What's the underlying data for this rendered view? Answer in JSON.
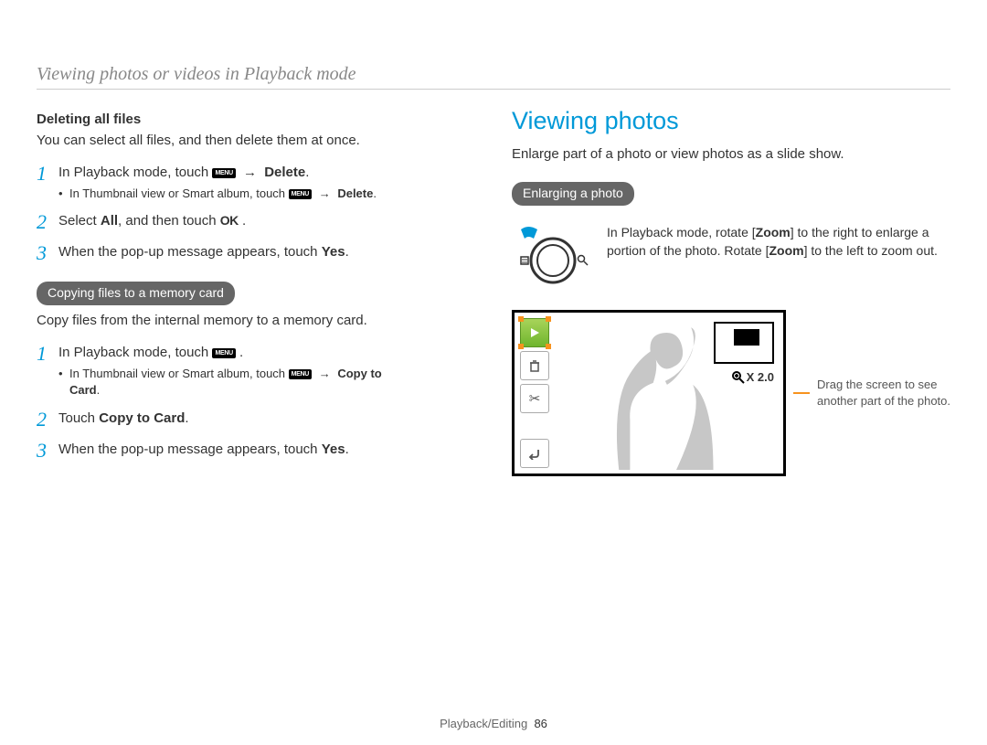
{
  "header": "Viewing photos or videos in Playback mode",
  "left": {
    "del_title": "Deleting all files",
    "del_desc": "You can select all files, and then delete them at once.",
    "del_steps": {
      "s1_pre": "In Playback mode, touch ",
      "s1_post": "Delete",
      "s1_sub_pre": "In Thumbnail view or Smart album, touch ",
      "s1_sub_post": "Delete",
      "s2_pre": "Select ",
      "s2_bold": "All",
      "s2_post": ", and then touch ",
      "s3_pre": "When the pop-up message appears, touch ",
      "s3_bold": "Yes",
      "s3_post": "."
    },
    "copy_pill": "Copying files to a memory card",
    "copy_desc": "Copy files from the internal memory to a memory card.",
    "copy_steps": {
      "s1": "In Playback mode, touch ",
      "s1_sub_pre": "In Thumbnail view or Smart album, touch ",
      "s1_sub_post1": "Copy to",
      "s1_sub_post2": "Card",
      "s2_pre": "Touch ",
      "s2_bold": "Copy to Card",
      "s2_post": ".",
      "s3_pre": "When the pop-up message appears, touch ",
      "s3_bold": "Yes",
      "s3_post": "."
    }
  },
  "right": {
    "title": "Viewing photos",
    "desc": "Enlarge part of a photo or view photos as a slide show.",
    "pill": "Enlarging a photo",
    "zoom_text_pre": "In Playback mode, rotate [",
    "zoom_bold1": "Zoom",
    "zoom_text_mid": "] to the right to enlarge a portion of the photo. Rotate [",
    "zoom_bold2": "Zoom",
    "zoom_text_post": "] to the left to zoom out.",
    "drag_text": "Drag the screen to see another part of the photo.",
    "zoom_label": "X 2.0",
    "menu_label": "MENU",
    "ok_label": "OK"
  },
  "footer_section": "Playback/Editing",
  "footer_page": "86"
}
